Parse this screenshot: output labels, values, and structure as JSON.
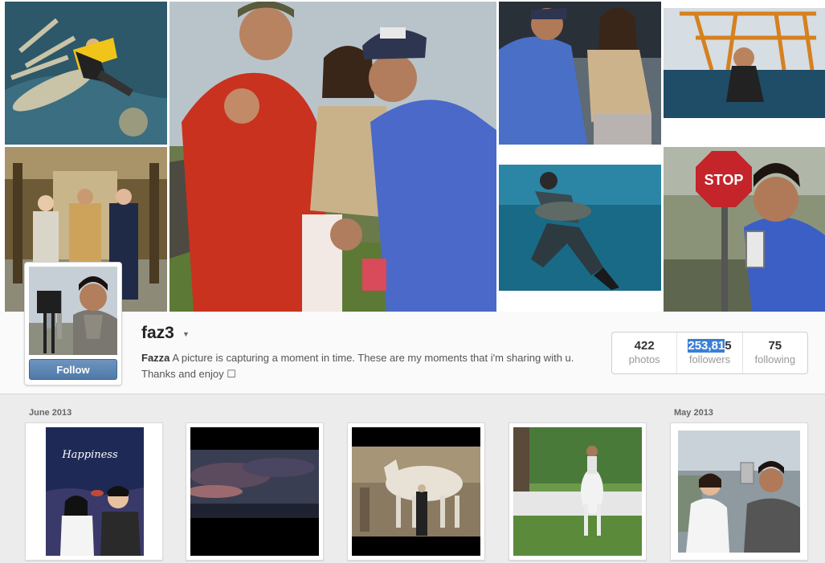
{
  "profile": {
    "username": "faz3",
    "follow_label": "Follow",
    "bio_name": "Fazza",
    "bio_text": "A picture is capturing a moment in time. These are my moments that i'm sharing with u. Thanks and enjoy ☐"
  },
  "stats": {
    "photos": {
      "value": "422",
      "label": "photos"
    },
    "followers": {
      "value_highlighted": "253,81",
      "value_rest": "5",
      "label": "followers"
    },
    "following": {
      "value": "75",
      "label": "following"
    }
  },
  "feed": {
    "months": [
      "June 2013",
      "May 2013"
    ]
  },
  "cover_tiles": [
    {
      "name": "cover-photo-skydive",
      "bg": "#2f5a6e"
    },
    {
      "name": "cover-photo-palace-hall",
      "bg": "#7a6a44"
    },
    {
      "name": "cover-photo-family-main",
      "bg": "#8da0b0"
    },
    {
      "name": "cover-photo-girl-car",
      "bg": "#5a6a7a"
    },
    {
      "name": "cover-photo-oil-rig",
      "bg": "#c88a3a"
    },
    {
      "name": "cover-photo-underwater",
      "bg": "#1d6d86"
    },
    {
      "name": "cover-photo-stop-sign",
      "bg": "#7c8a6e"
    }
  ],
  "colors": {
    "accent": "#4f79a8",
    "selection": "#3a7fd5"
  },
  "icons": [
    "caret-down-icon"
  ]
}
